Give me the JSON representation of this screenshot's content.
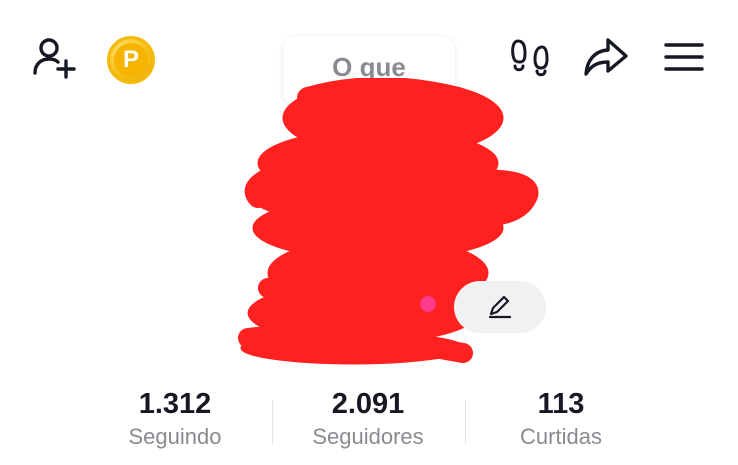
{
  "header": {
    "add_friend_icon": "person-add-icon",
    "coin_icon": "coin-icon",
    "coin_letter": "P",
    "footprints_icon": "footprints-icon",
    "share_icon": "share-arrow-icon",
    "menu_icon": "hamburger-menu-icon"
  },
  "bubble": {
    "text": "O que"
  },
  "profile": {
    "edit_icon": "pencil-icon"
  },
  "stats": [
    {
      "value": "1.312",
      "label": "Seguindo"
    },
    {
      "value": "2.091",
      "label": "Seguidores"
    },
    {
      "value": "113",
      "label": "Curtidas"
    }
  ],
  "colors": {
    "redaction": "#ff2020",
    "coin": "#f7c21b",
    "accent_dot": "#ff3b8d",
    "muted_text": "#8a8b91",
    "primary_text": "#161823"
  }
}
